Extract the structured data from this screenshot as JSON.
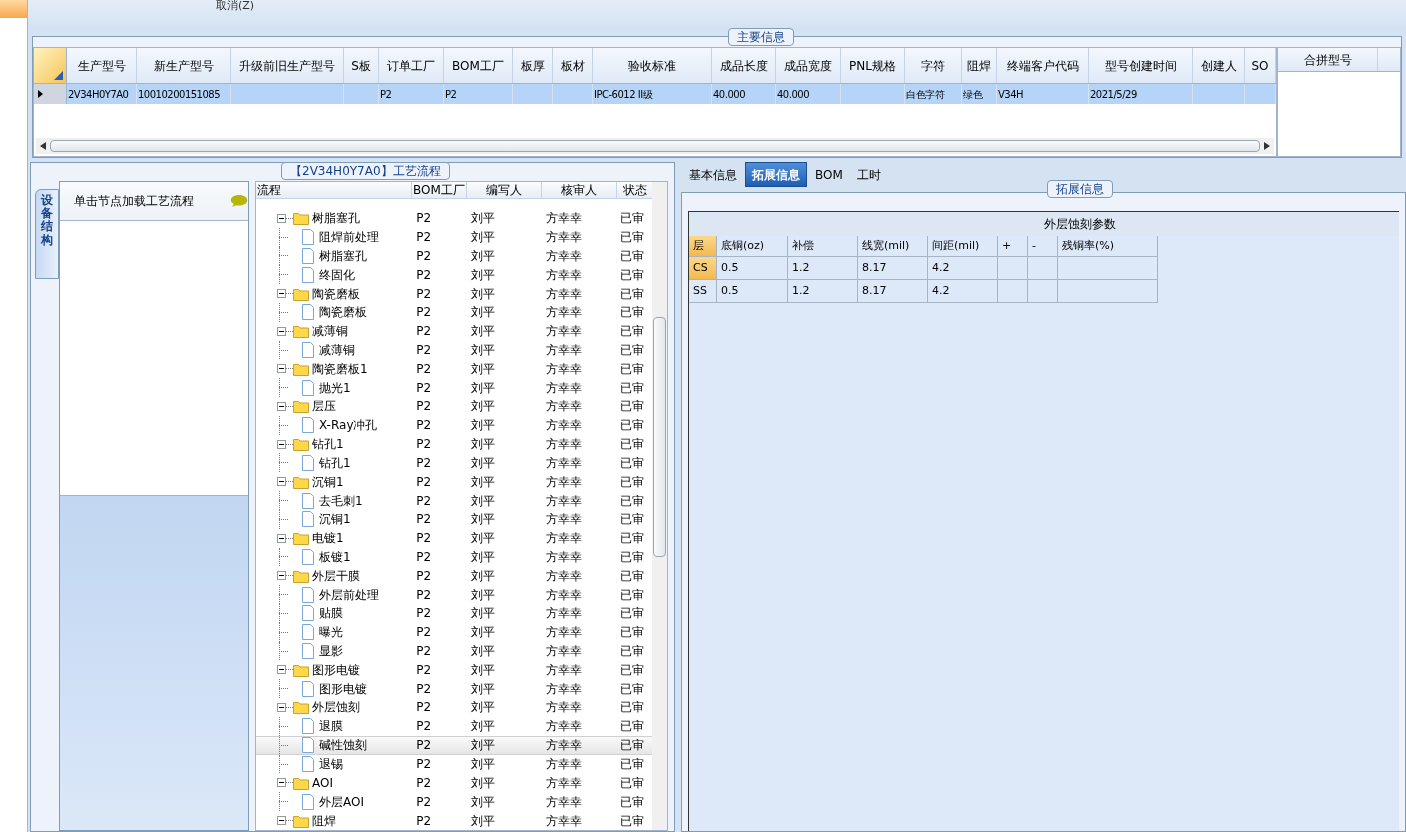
{
  "toolbar": {
    "cancel_button": "取消(Z)"
  },
  "main_info": {
    "title": "主要信息",
    "columns": [
      "生产型号",
      "新生产型号",
      "升级前旧生产型号",
      "S板",
      "订单工厂",
      "BOM工厂",
      "板厚",
      "板材",
      "验收标准",
      "成品长度",
      "成品宽度",
      "PNL规格",
      "字符",
      "阻焊",
      "终端客户代码",
      "型号创建时间",
      "创建人",
      "SO"
    ],
    "rows": [
      {
        "selected": true,
        "cells": [
          "2V34H0Y7A0",
          "10010200151085",
          "",
          "",
          "P2",
          "P2",
          "",
          "",
          "IPC-6012 II级",
          "40.000",
          "40.000",
          "",
          "白色字符",
          "绿色",
          "V34H",
          "2021/5/29",
          "",
          ""
        ]
      }
    ],
    "side_columns": [
      "合拼型号"
    ]
  },
  "process_panel": {
    "title": "【2V34H0Y7A0】工艺流程",
    "side_tab": "设备结构",
    "nav_header": "单击节点加载工艺流程",
    "columns": [
      "流程",
      "BOM工厂",
      "编写人",
      "核审人",
      "状态"
    ],
    "tree": [
      {
        "label": "树脂塞孔",
        "cells": [
          "P2",
          "刘平",
          "方幸幸",
          "已审"
        ],
        "expanded": true,
        "selected": false,
        "children": [
          {
            "label": "阻焊前处理",
            "cells": [
              "P2",
              "刘平",
              "方幸幸",
              "已审"
            ],
            "selected": false
          },
          {
            "label": "树脂塞孔",
            "cells": [
              "P2",
              "刘平",
              "方幸幸",
              "已审"
            ],
            "selected": false
          },
          {
            "label": "终固化",
            "cells": [
              "P2",
              "刘平",
              "方幸幸",
              "已审"
            ],
            "selected": false
          }
        ]
      },
      {
        "label": "陶瓷磨板",
        "cells": [
          "P2",
          "刘平",
          "方幸幸",
          "已审"
        ],
        "expanded": true,
        "selected": false,
        "children": [
          {
            "label": "陶瓷磨板",
            "cells": [
              "P2",
              "刘平",
              "方幸幸",
              "已审"
            ],
            "selected": false
          }
        ]
      },
      {
        "label": "减薄铜",
        "cells": [
          "P2",
          "刘平",
          "方幸幸",
          "已审"
        ],
        "expanded": true,
        "selected": false,
        "children": [
          {
            "label": "减薄铜",
            "cells": [
              "P2",
              "刘平",
              "方幸幸",
              "已审"
            ],
            "selected": false
          }
        ]
      },
      {
        "label": "陶瓷磨板1",
        "cells": [
          "P2",
          "刘平",
          "方幸幸",
          "已审"
        ],
        "expanded": true,
        "selected": false,
        "children": [
          {
            "label": "抛光1",
            "cells": [
              "P2",
              "刘平",
              "方幸幸",
              "已审"
            ],
            "selected": false
          }
        ]
      },
      {
        "label": "层压",
        "cells": [
          "P2",
          "刘平",
          "方幸幸",
          "已审"
        ],
        "expanded": true,
        "selected": false,
        "children": [
          {
            "label": "X-Ray冲孔",
            "cells": [
              "P2",
              "刘平",
              "方幸幸",
              "已审"
            ],
            "selected": false
          }
        ]
      },
      {
        "label": "钻孔1",
        "cells": [
          "P2",
          "刘平",
          "方幸幸",
          "已审"
        ],
        "expanded": true,
        "selected": false,
        "children": [
          {
            "label": "钻孔1",
            "cells": [
              "P2",
              "刘平",
              "方幸幸",
              "已审"
            ],
            "selected": false
          }
        ]
      },
      {
        "label": "沉铜1",
        "cells": [
          "P2",
          "刘平",
          "方幸幸",
          "已审"
        ],
        "expanded": true,
        "selected": false,
        "children": [
          {
            "label": "去毛刺1",
            "cells": [
              "P2",
              "刘平",
              "方幸幸",
              "已审"
            ],
            "selected": false
          },
          {
            "label": "沉铜1",
            "cells": [
              "P2",
              "刘平",
              "方幸幸",
              "已审"
            ],
            "selected": false
          }
        ]
      },
      {
        "label": "电镀1",
        "cells": [
          "P2",
          "刘平",
          "方幸幸",
          "已审"
        ],
        "expanded": true,
        "selected": false,
        "children": [
          {
            "label": "板镀1",
            "cells": [
              "P2",
              "刘平",
              "方幸幸",
              "已审"
            ],
            "selected": false
          }
        ]
      },
      {
        "label": "外层干膜",
        "cells": [
          "P2",
          "刘平",
          "方幸幸",
          "已审"
        ],
        "expanded": true,
        "selected": false,
        "children": [
          {
            "label": "外层前处理",
            "cells": [
              "P2",
              "刘平",
              "方幸幸",
              "已审"
            ],
            "selected": false
          },
          {
            "label": "贴膜",
            "cells": [
              "P2",
              "刘平",
              "方幸幸",
              "已审"
            ],
            "selected": false
          },
          {
            "label": "曝光",
            "cells": [
              "P2",
              "刘平",
              "方幸幸",
              "已审"
            ],
            "selected": false
          },
          {
            "label": "显影",
            "cells": [
              "P2",
              "刘平",
              "方幸幸",
              "已审"
            ],
            "selected": false
          }
        ]
      },
      {
        "label": "图形电镀",
        "cells": [
          "P2",
          "刘平",
          "方幸幸",
          "已审"
        ],
        "expanded": true,
        "selected": false,
        "children": [
          {
            "label": "图形电镀",
            "cells": [
              "P2",
              "刘平",
              "方幸幸",
              "已审"
            ],
            "selected": false
          }
        ]
      },
      {
        "label": "外层蚀刻",
        "cells": [
          "P2",
          "刘平",
          "方幸幸",
          "已审"
        ],
        "expanded": true,
        "selected": false,
        "children": [
          {
            "label": "退膜",
            "cells": [
              "P2",
              "刘平",
              "方幸幸",
              "已审"
            ],
            "selected": false
          },
          {
            "label": "碱性蚀刻",
            "cells": [
              "P2",
              "刘平",
              "方幸幸",
              "已审"
            ],
            "selected": true
          },
          {
            "label": "退锡",
            "cells": [
              "P2",
              "刘平",
              "方幸幸",
              "已审"
            ],
            "selected": false
          }
        ]
      },
      {
        "label": "AOI",
        "cells": [
          "P2",
          "刘平",
          "方幸幸",
          "已审"
        ],
        "expanded": true,
        "selected": false,
        "children": [
          {
            "label": "外层AOI",
            "cells": [
              "P2",
              "刘平",
              "方幸幸",
              "已审"
            ],
            "selected": false
          }
        ]
      },
      {
        "label": "阻焊",
        "cells": [
          "P2",
          "刘平",
          "方幸幸",
          "已审"
        ],
        "expanded": true,
        "selected": false
      }
    ]
  },
  "detail_panel": {
    "tabs": [
      {
        "label": "基本信息",
        "selected": false
      },
      {
        "label": "拓展信息",
        "selected": true
      },
      {
        "label": "BOM",
        "selected": false
      },
      {
        "label": "工时",
        "selected": false
      }
    ],
    "group_title": "拓展信息",
    "table": {
      "title": "外层蚀刻参数",
      "columns": [
        "层",
        "底铜(oz)",
        "补偿",
        "线宽(mil)",
        "间距(mil)",
        "+",
        "-",
        "残铜率(%)"
      ],
      "rows": [
        {
          "selected": true,
          "cells": [
            "CS",
            "0.5",
            "1.2",
            "8.17",
            "4.2",
            "",
            "",
            ""
          ]
        },
        {
          "selected": false,
          "cells": [
            "SS",
            "0.5",
            "1.2",
            "8.17",
            "4.2",
            "",
            "",
            ""
          ]
        }
      ]
    }
  }
}
